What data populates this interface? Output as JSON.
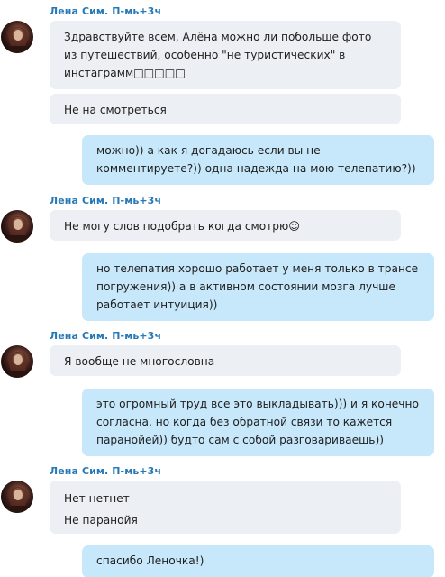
{
  "sender": {
    "name": "Лена Сим.",
    "time": "П-мь+3ч"
  },
  "messages": [
    {
      "id": "m1",
      "direction": "in",
      "text": "Здравствуйте всем, Алёна  можно ли побольше фото\nиз путешествий, особенно \"не туристических\" в\nинстаграмм□□□□□"
    },
    {
      "id": "m2",
      "direction": "in",
      "text": "Не на смотреться"
    },
    {
      "id": "m3",
      "direction": "out",
      "text": "можно)) а как я догадаюсь если вы не\nкомментируете?)) одна надежда на мою телепатию?))"
    },
    {
      "id": "m4",
      "direction": "in",
      "text": "Не могу слов подобрать когда смотрю☺"
    },
    {
      "id": "m5",
      "direction": "out",
      "text": "но телепатия хорошо работает у меня только в трансе\nпогружения)) а в активном состоянии мозга лучше\nработает интуиция))"
    },
    {
      "id": "m6",
      "direction": "in",
      "text": "Я вообще не многословна"
    },
    {
      "id": "m7",
      "direction": "out",
      "text": "это огромный труд все это выкладывать))) и я конечно\nсогласна. но когда без обратной связи то кажется\nпаранойей)) будто сам с собой разговариваешь))"
    },
    {
      "id": "m8",
      "direction": "in",
      "text": "Нет нетнет\nНе паранойя"
    },
    {
      "id": "m9",
      "direction": "out",
      "text": "спасибо Леночка!)"
    }
  ],
  "colors": {
    "incoming_bubble": "#eceff3",
    "outgoing_bubble": "#c7e8fa",
    "sender_name": "#2679b7"
  }
}
